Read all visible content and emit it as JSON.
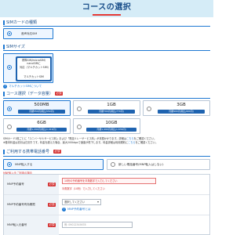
{
  "page": {
    "title": "コースの選択"
  },
  "sections": {
    "sim_type": "SIMカードの種類",
    "sim_size": "SIMサイズ",
    "course": "コース選択（データ容量）",
    "mnp": "ご利用する携帯電話番号"
  },
  "sim_type": {
    "selected_label": "音声対応SIM"
  },
  "sim_size": {
    "chip_lines": [
      "標準SIM/microSIM/",
      "nanoSIMに",
      "対応（マルチカットSIM）"
    ],
    "chip_caption": "マルチカットSIM",
    "link": "マルチカットSIMについて"
  },
  "course": {
    "required": "必須",
    "plans": [
      {
        "name": "500MB",
        "price": "月額550円(税込550円)",
        "selected": true
      },
      {
        "name": "1GB",
        "price": "月額700円(税込770円)",
        "selected": false
      },
      {
        "name": "3GB",
        "price": "月額900円(税込990円)",
        "selected": false
      },
      {
        "name": "6GB",
        "price": "月額1,290円(税込1,419円)",
        "selected": false
      },
      {
        "name": "10GB",
        "price": "月額1,490円(税込1,639円)",
        "selected": false
      }
    ],
    "note_line1": "SIMカード1枚ごとに「ユニバーサルサービス料」および「電話リレーサービス料」が月額かかります。詳細は",
    "note_link1": "こちら",
    "note_line1_end": "をご確認ください。",
    "note_line2": "※基本料金は初月は日割りです。料金を超えた場合、最大200kbpsで速度が低下します。料金詳細は利用規約に",
    "note_link2": "こちら",
    "note_line2_end": "をご確認ください。"
  },
  "mnp": {
    "required": "必須",
    "option_transfer": "MNP転入する",
    "option_new": "新しい電話番号(MNP転入はしない)",
    "warning": "MNP転入をご利用の場合"
  },
  "form": {
    "required": "必須",
    "rows": [
      {
        "label": "MNP予約番号",
        "value": "10桁の予約番号を半角数字で入力してください",
        "error": "半角数字（10桁）で入力してください"
      },
      {
        "label": "MNP予約番号有効期限",
        "select_value": "選択してください",
        "link": "MNP予約番号とは"
      },
      {
        "label": "MNP転入元番号",
        "value": "例: 09012345678"
      }
    ]
  },
  "colors": {
    "accent": "#1e78d2",
    "brand": "#1e63b0",
    "required": "#d32f2f",
    "title_bg": "#d5ecf7"
  }
}
